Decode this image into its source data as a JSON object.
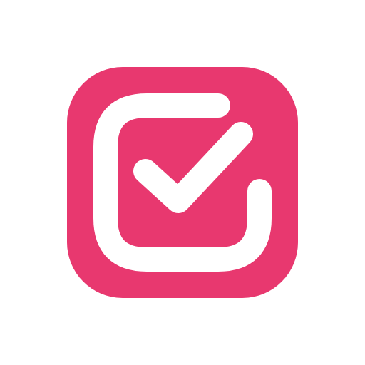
{
  "icon": {
    "name": "checkbox-check-icon",
    "colors": {
      "brand": "#E8386F",
      "background": "#FFFFFF",
      "foreground": "#FFFFFF"
    }
  }
}
